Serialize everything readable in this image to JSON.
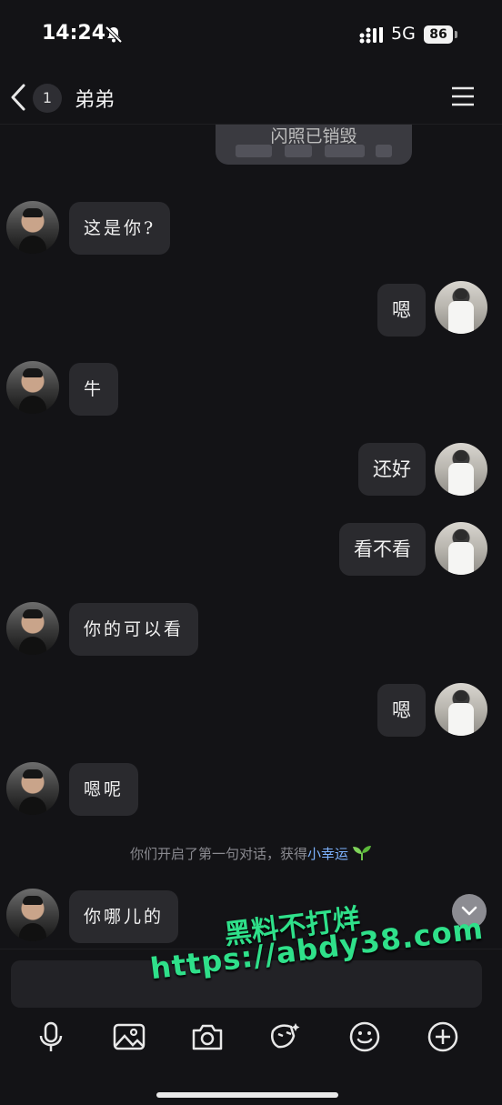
{
  "status": {
    "time": "14:24",
    "network": "5G",
    "battery": "86"
  },
  "header": {
    "unread_count": "1",
    "contact_name": "弟弟"
  },
  "flash": {
    "label": "闪照已销毁"
  },
  "messages": [
    {
      "side": "left",
      "text": "这是你?"
    },
    {
      "side": "right",
      "text": "嗯"
    },
    {
      "side": "left",
      "text": "牛"
    },
    {
      "side": "right",
      "text": "还好"
    },
    {
      "side": "right",
      "text": "看不看"
    },
    {
      "side": "left",
      "text": "你的可以看"
    },
    {
      "side": "right",
      "text": "嗯"
    },
    {
      "side": "left",
      "text": "嗯呢"
    },
    {
      "side": "left",
      "text": "你哪儿的"
    }
  ],
  "system_notice": {
    "text": "你们开启了第一句对话，获得",
    "highlight": "小幸运"
  },
  "toolbar_icons": [
    "microphone-icon",
    "image-icon",
    "camera-icon",
    "sticker-icon",
    "emoji-icon",
    "plus-icon"
  ],
  "watermark": {
    "line1": "黑料不打烊",
    "line2": "https://abdy38.com"
  },
  "colors": {
    "background": "#131316",
    "bubble": "#2a2a2e",
    "highlight": "#7eb3ff",
    "watermark": "#2fe08a"
  }
}
